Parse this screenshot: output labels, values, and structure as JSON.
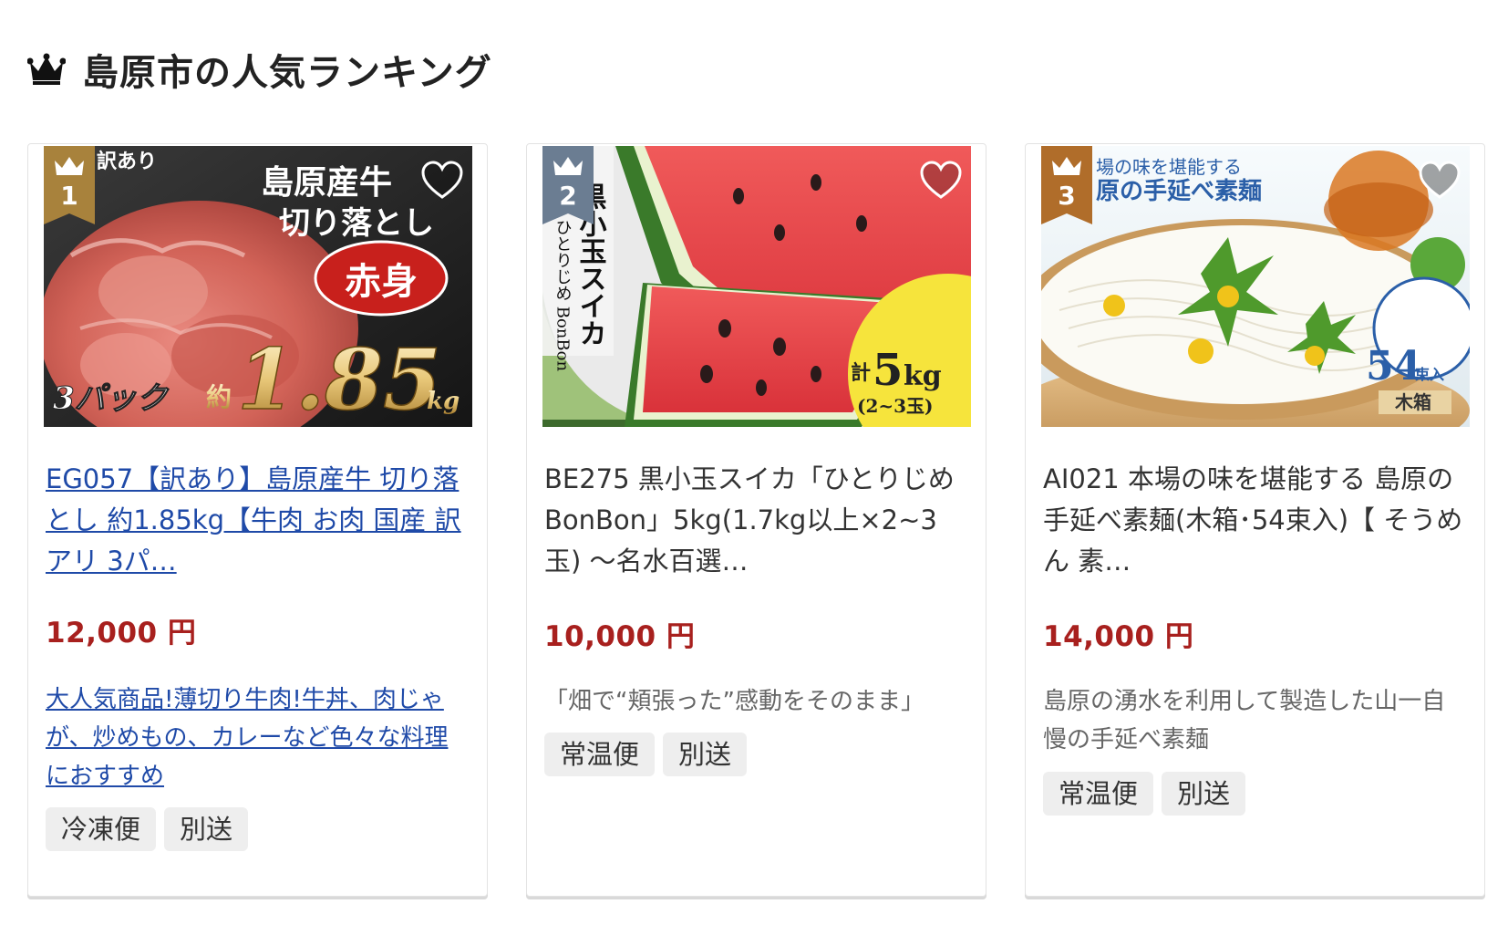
{
  "section": {
    "title": "島原市の人気ランキング",
    "icon": "crown-icon"
  },
  "colors": {
    "price": "#a8201e",
    "link": "#1f4aa8",
    "rank_gold": "#a8823c",
    "rank_silver": "#6b7d92",
    "rank_bronze": "#b06d2a"
  },
  "cards": [
    {
      "rank": "1",
      "title": "EG057【訳あり】島原産牛 切り落とし 約1.85kg【牛肉 お肉 国産 訳アリ 3パ…",
      "price": "12,000 円",
      "description": "大人気商品!薄切り牛肉!牛丼、肉じゃが、炒めもの、カレーなど色々な料理におすすめ",
      "tags": [
        "冷凍便",
        "別送"
      ],
      "image": {
        "headline": "島原産牛",
        "subheadline": "切り落とし",
        "badge": "赤身",
        "corner": "訳あり",
        "weight_prefix": "約",
        "weight": "1.85",
        "weight_unit": "kg",
        "packs": "3パック"
      }
    },
    {
      "rank": "2",
      "title": "BE275 黒小玉スイカ「ひとりじめBonBon」5kg(1.7kg以上×2~3玉) ～名水百選…",
      "price": "10,000 円",
      "description": "「畑で“頬張った”感動をそのまま」",
      "tags": [
        "常温便",
        "別送"
      ],
      "image": {
        "vertical_title": "黒小玉スイカ",
        "vertical_sub": "ひとりじめ BonBon",
        "weight_prefix": "計",
        "weight": "5",
        "weight_unit": "kg",
        "count": "(2~3玉)"
      }
    },
    {
      "rank": "3",
      "title": "AI021 本場の味を堪能する 島原の手延べ素麺(木箱･54束入)【 そうめん 素…",
      "price": "14,000 円",
      "description": "島原の湧水を利用して製造した山一自慢の手延べ素麺",
      "tags": [
        "常温便",
        "別送"
      ],
      "image": {
        "line1": "場の味を堪能する",
        "line2": "原の手延べ素麺",
        "count": "54",
        "count_unit": "束入",
        "box": "木箱"
      }
    }
  ]
}
